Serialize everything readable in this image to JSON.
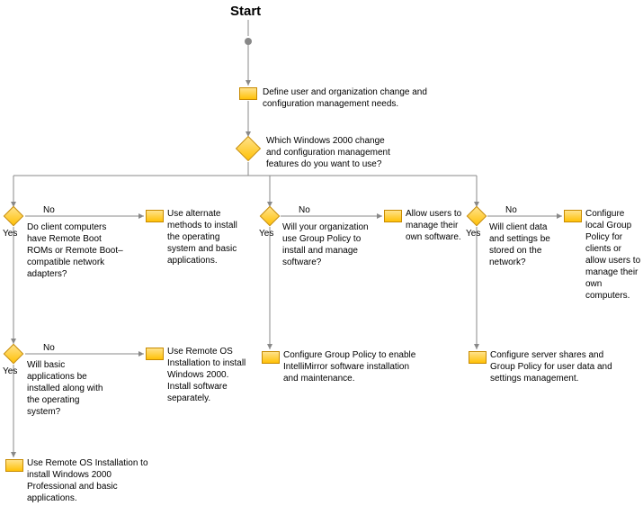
{
  "start": "Start",
  "step1": "Define user and organization change and configuration management needs.",
  "decision_main": "Which Windows 2000 change and configuration management features do you want to use?",
  "branch_a": {
    "q1": "Do client computers have Remote Boot ROMs or Remote Boot–compatible network adapters?",
    "q1_no": "Use alternate methods to install the operating system and basic applications.",
    "q2": "Will basic applications be installed along with the operating system?",
    "q2_no": "Use Remote OS Installation to install Windows 2000. Install software separately.",
    "q2_yes": "Use Remote OS Installation to install Windows 2000 Professional and basic applications."
  },
  "branch_b": {
    "q1": "Will your organization use Group Policy to install and manage software?",
    "q1_no": "Allow users to manage their own software.",
    "q1_yes": "Configure Group Policy to enable IntelliMirror software installation and maintenance."
  },
  "branch_c": {
    "q1": "Will client data and settings be stored on the network?",
    "q1_no": "Configure local Group Policy for clients or allow users to manage their own computers.",
    "q1_yes": "Configure server shares and Group Policy for user data and settings management."
  },
  "labels": {
    "yes": "Yes",
    "no": "No"
  }
}
